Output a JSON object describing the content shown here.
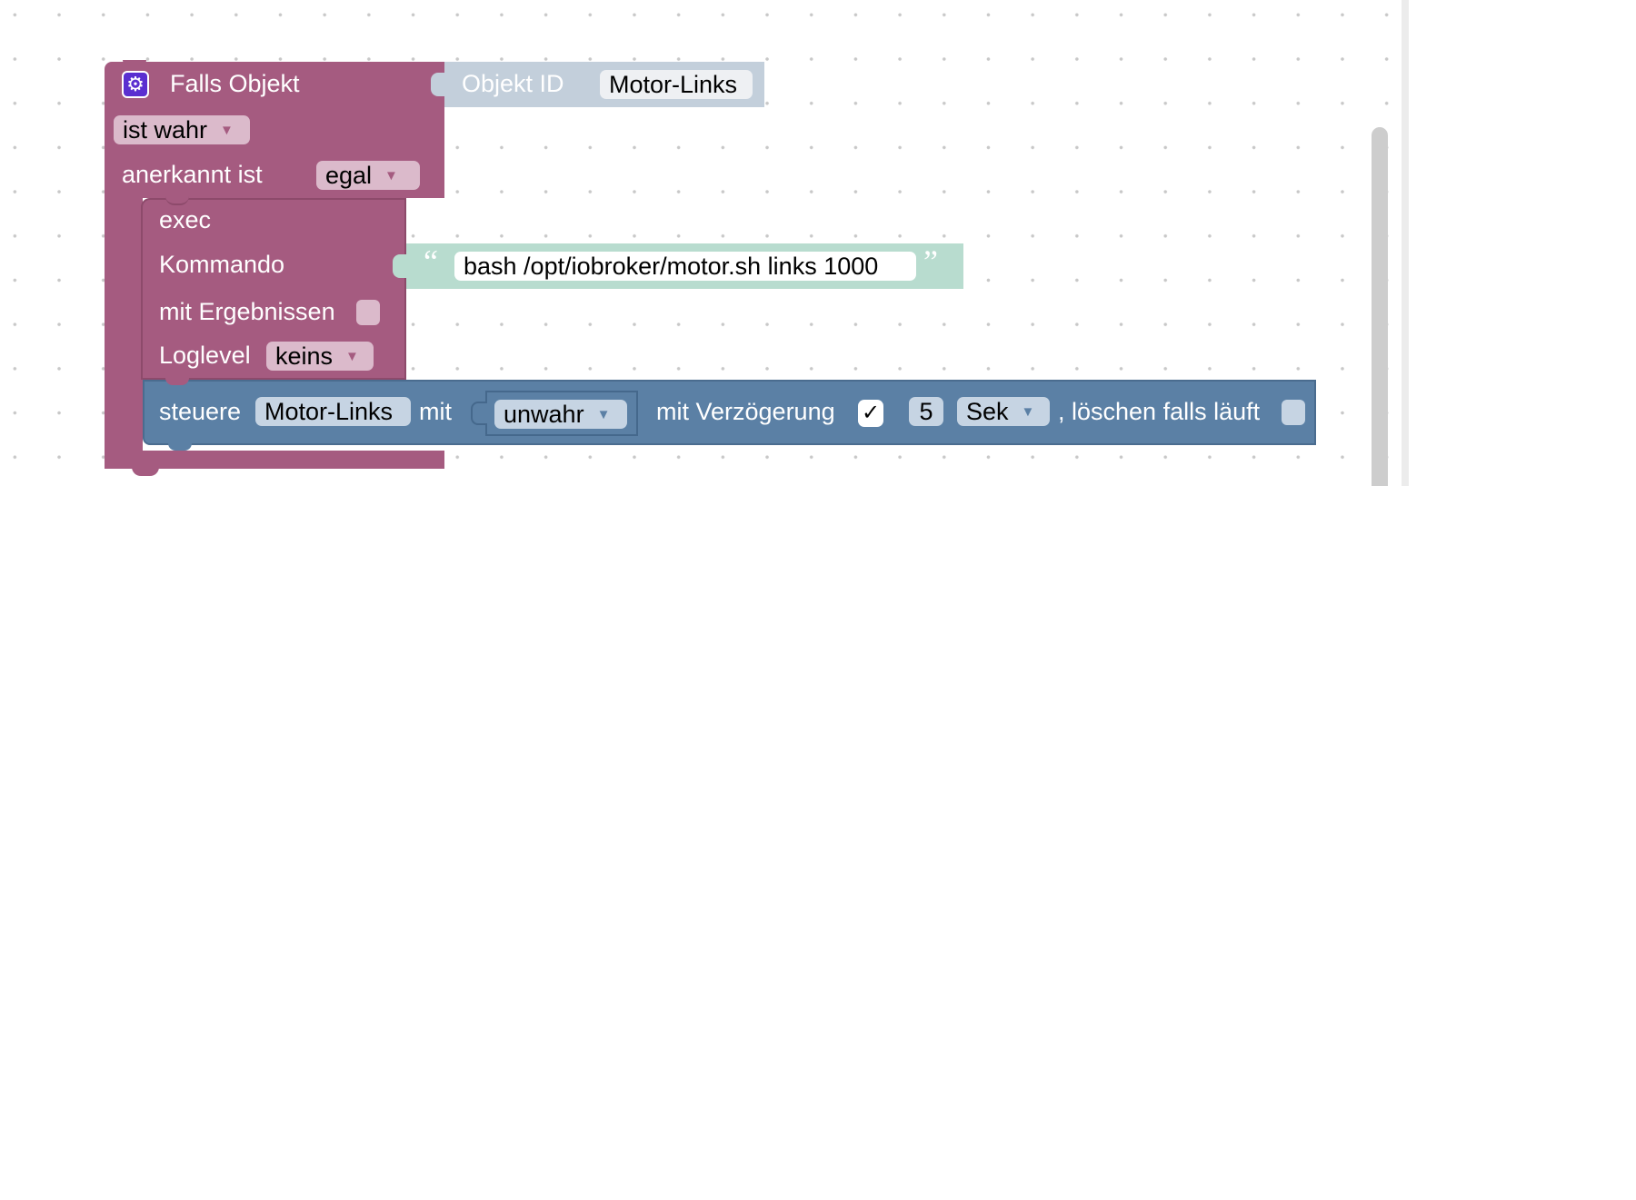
{
  "event_block": {
    "title": "Falls Objekt",
    "object_id_label": "Objekt ID",
    "object_id_value": "Motor-Links",
    "condition": "ist wahr",
    "ack_label": "anerkannt ist",
    "ack_value": "egal"
  },
  "exec_block": {
    "title": "exec",
    "command_label": "Kommando",
    "command_value": "bash /opt/iobroker/motor.sh links 1000",
    "open_quote": "“",
    "close_quote": "”",
    "results_label": "mit Ergebnissen",
    "loglevel_label": "Loglevel",
    "loglevel_value": "keins"
  },
  "control_block": {
    "label_control": "steuere",
    "target": "Motor-Links",
    "label_with": "mit",
    "value": "unwahr",
    "delay_label": "mit Verzögerung",
    "delay_checked_mark": "✓",
    "delay_amount": "5",
    "delay_unit": "Sek",
    "clear_label": ", löschen falls läuft"
  },
  "colors": {
    "event": "#a55b80",
    "control": "#5b80a5",
    "text": "#b8dccf",
    "object_id": "#c3cfdb",
    "gear_icon": "#5a2fd0"
  },
  "icons": {
    "gear": "⚙",
    "dropdown": "▼"
  }
}
